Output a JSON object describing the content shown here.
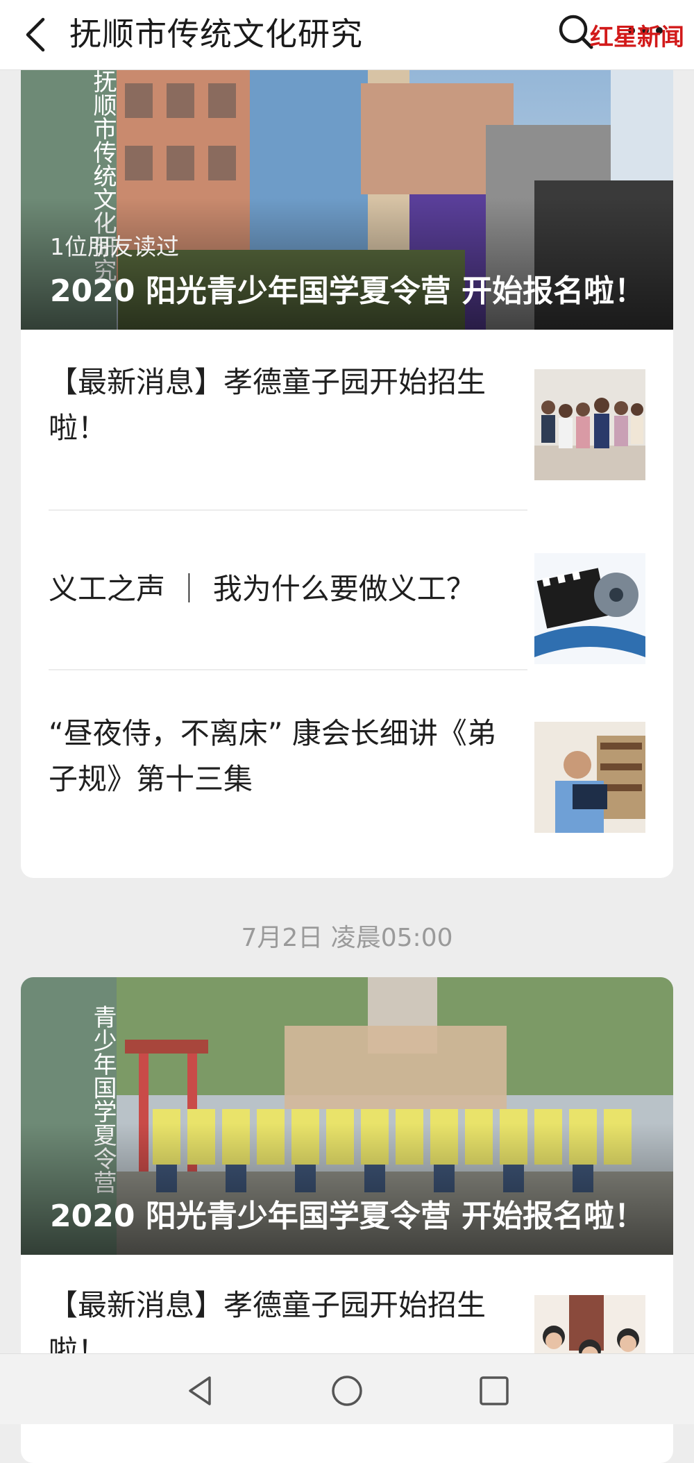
{
  "topbar": {
    "title": "抚顺市传统文化研究",
    "back_icon": "back-arrow-icon",
    "search_icon": "search-icon",
    "more_icon": "more-dots-icon"
  },
  "card1": {
    "cover": {
      "banner_text": "抚顺市传统文化研究",
      "readers_text": "1位朋友读过",
      "headline": "2020 阳光青少年国学夏令营 开始报名啦！"
    },
    "articles": [
      {
        "title": "【最新消息】孝德童子园开始招生啦！"
      },
      {
        "title": "义工之声 ｜ 我为什么要做义工？"
      },
      {
        "title": "“昼夜侍，不离床” 康会长细讲《弟子规》第十三集"
      }
    ]
  },
  "timestamp": "7月2日 凌晨05:00",
  "card2": {
    "cover": {
      "banner_text": "青少年国学夏令营",
      "headline": "2020 阳光青少年国学夏令营 开始报名啦！"
    },
    "articles": [
      {
        "title": "【最新消息】孝德童子园开始招生啦！"
      }
    ]
  },
  "navbar": {
    "back_icon": "nav-back-triangle-icon",
    "home_icon": "nav-home-circle-icon",
    "recent_icon": "nav-recent-square-icon"
  },
  "watermark": "红星新闻",
  "colors": {
    "banner_green": "#6e8a76",
    "background": "#ededed",
    "brand_red": "#d21a1a"
  }
}
